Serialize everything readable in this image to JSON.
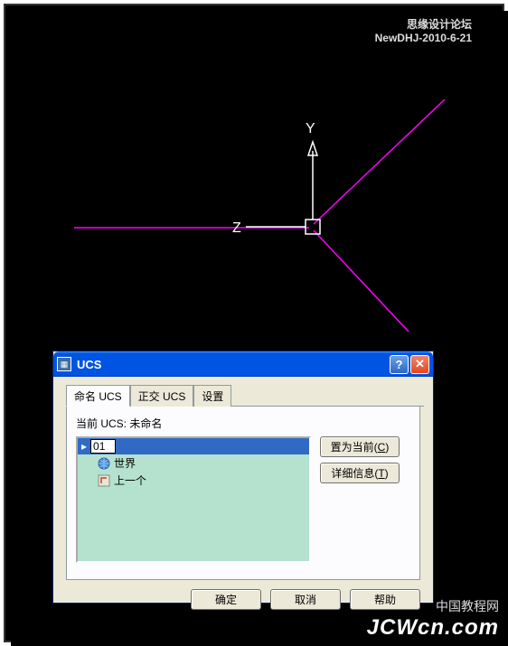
{
  "header": {
    "forum_text": "思缘设计论坛",
    "filename": "NewDHJ-2010-6-21"
  },
  "axes": {
    "y_label": "Y",
    "z_label": "Z"
  },
  "dialog": {
    "title": "UCS",
    "help_btn": "?",
    "close_btn": "✕",
    "tabs": {
      "named": "命名 UCS",
      "ortho": "正交 UCS",
      "settings": "设置"
    },
    "current_label": "当前 UCS: 未命名",
    "tree": {
      "editing_value": "01",
      "items": [
        {
          "label": "世界"
        },
        {
          "label": "上一个"
        }
      ]
    },
    "buttons": {
      "set_current": "置为当前",
      "set_current_key": "C",
      "details": "详细信息",
      "details_key": "T",
      "ok": "确定",
      "cancel": "取消",
      "help": "帮助"
    }
  },
  "watermark": {
    "line1": "中国教程网",
    "line2": "JCWcn.com"
  }
}
